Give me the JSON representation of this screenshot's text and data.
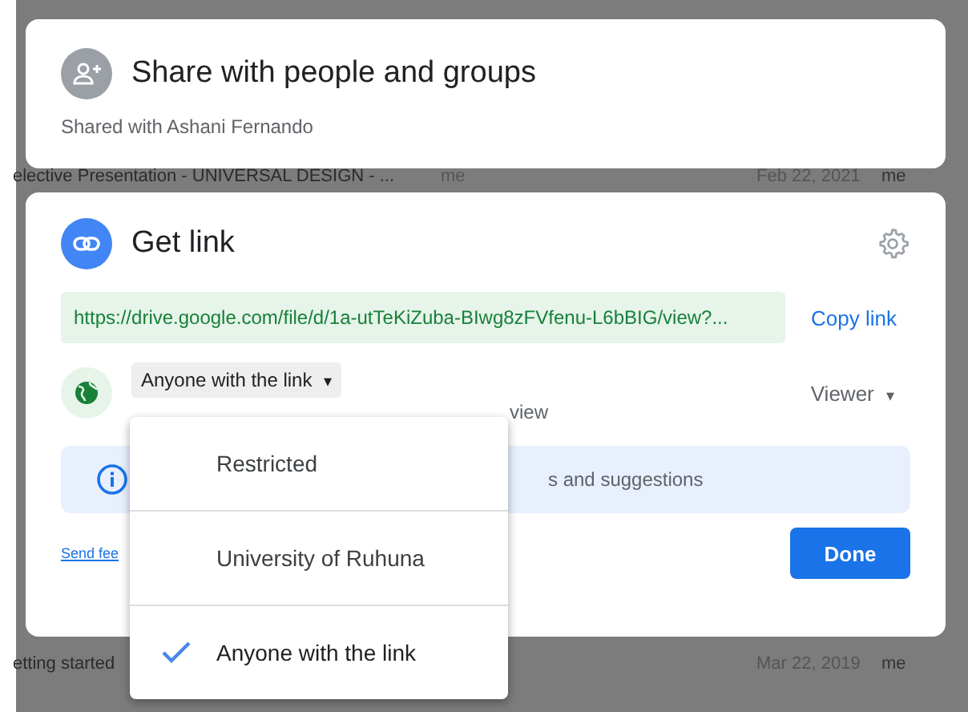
{
  "background_rows": [
    {
      "name": "elective Presentation - UNIVERSAL DESIGN - ...",
      "owner": "me",
      "date": "Feb 22, 2021",
      "modified_by": "me"
    },
    {
      "name": "etting started",
      "date": "Mar 22, 2019",
      "modified_by": "me"
    }
  ],
  "share_card": {
    "title": "Share with people and groups",
    "subtitle": "Shared with Ashani Fernando"
  },
  "link_card": {
    "title": "Get link",
    "url": "https://drive.google.com/file/d/1a-utTeKiZuba-BIwg8zFVfenu-L6bBIG/view?...",
    "copy_label": "Copy link",
    "access_label": "Anyone with the link",
    "caret": "▾",
    "access_hint_fragment": "view",
    "role": "Viewer",
    "role_caret": "▾",
    "info_fragment": "s and suggestions",
    "feedback_fragment": "Send fee",
    "done_label": "Done"
  },
  "access_menu": [
    {
      "label": "Restricted",
      "selected": false
    },
    {
      "label": "University of Ruhuna",
      "selected": false
    },
    {
      "label": "Anyone with the link",
      "selected": true
    }
  ]
}
